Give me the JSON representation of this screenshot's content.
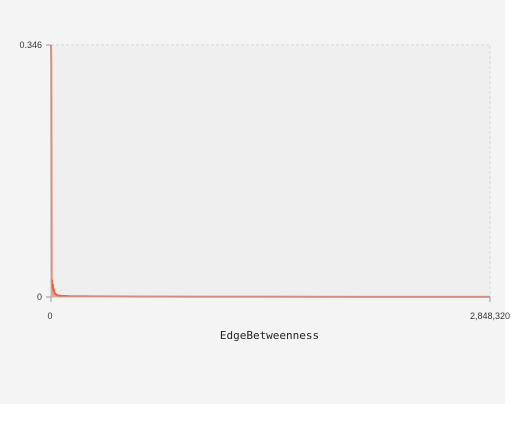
{
  "chart_data": {
    "type": "area",
    "title": "",
    "xlabel": "EdgeBetweenness",
    "ylabel": "",
    "xlim": [
      0,
      2848320
    ],
    "ylim": [
      0,
      0.346
    ],
    "x_tick_labels": [
      "0",
      "2,848,320"
    ],
    "y_tick_labels": [
      "0.346",
      "0"
    ],
    "grid": false,
    "series": [
      {
        "x": [
          0,
          1500,
          3000,
          6000,
          9000,
          12000,
          15000,
          18000,
          24000,
          30000,
          45000,
          70000,
          120000,
          300000,
          1000000,
          2000000,
          2848320
        ],
        "values": [
          0.346,
          0.32,
          0.018,
          0.024,
          0.012,
          0.018,
          0.008,
          0.011,
          0.005,
          0.004,
          0.002,
          0.0015,
          0.001,
          0.0006,
          0.0004,
          0.0002,
          0.0001
        ]
      }
    ]
  },
  "colors": {
    "series": "#e8643c",
    "plot_background": "#efefef",
    "border": "#d8d8d8"
  }
}
